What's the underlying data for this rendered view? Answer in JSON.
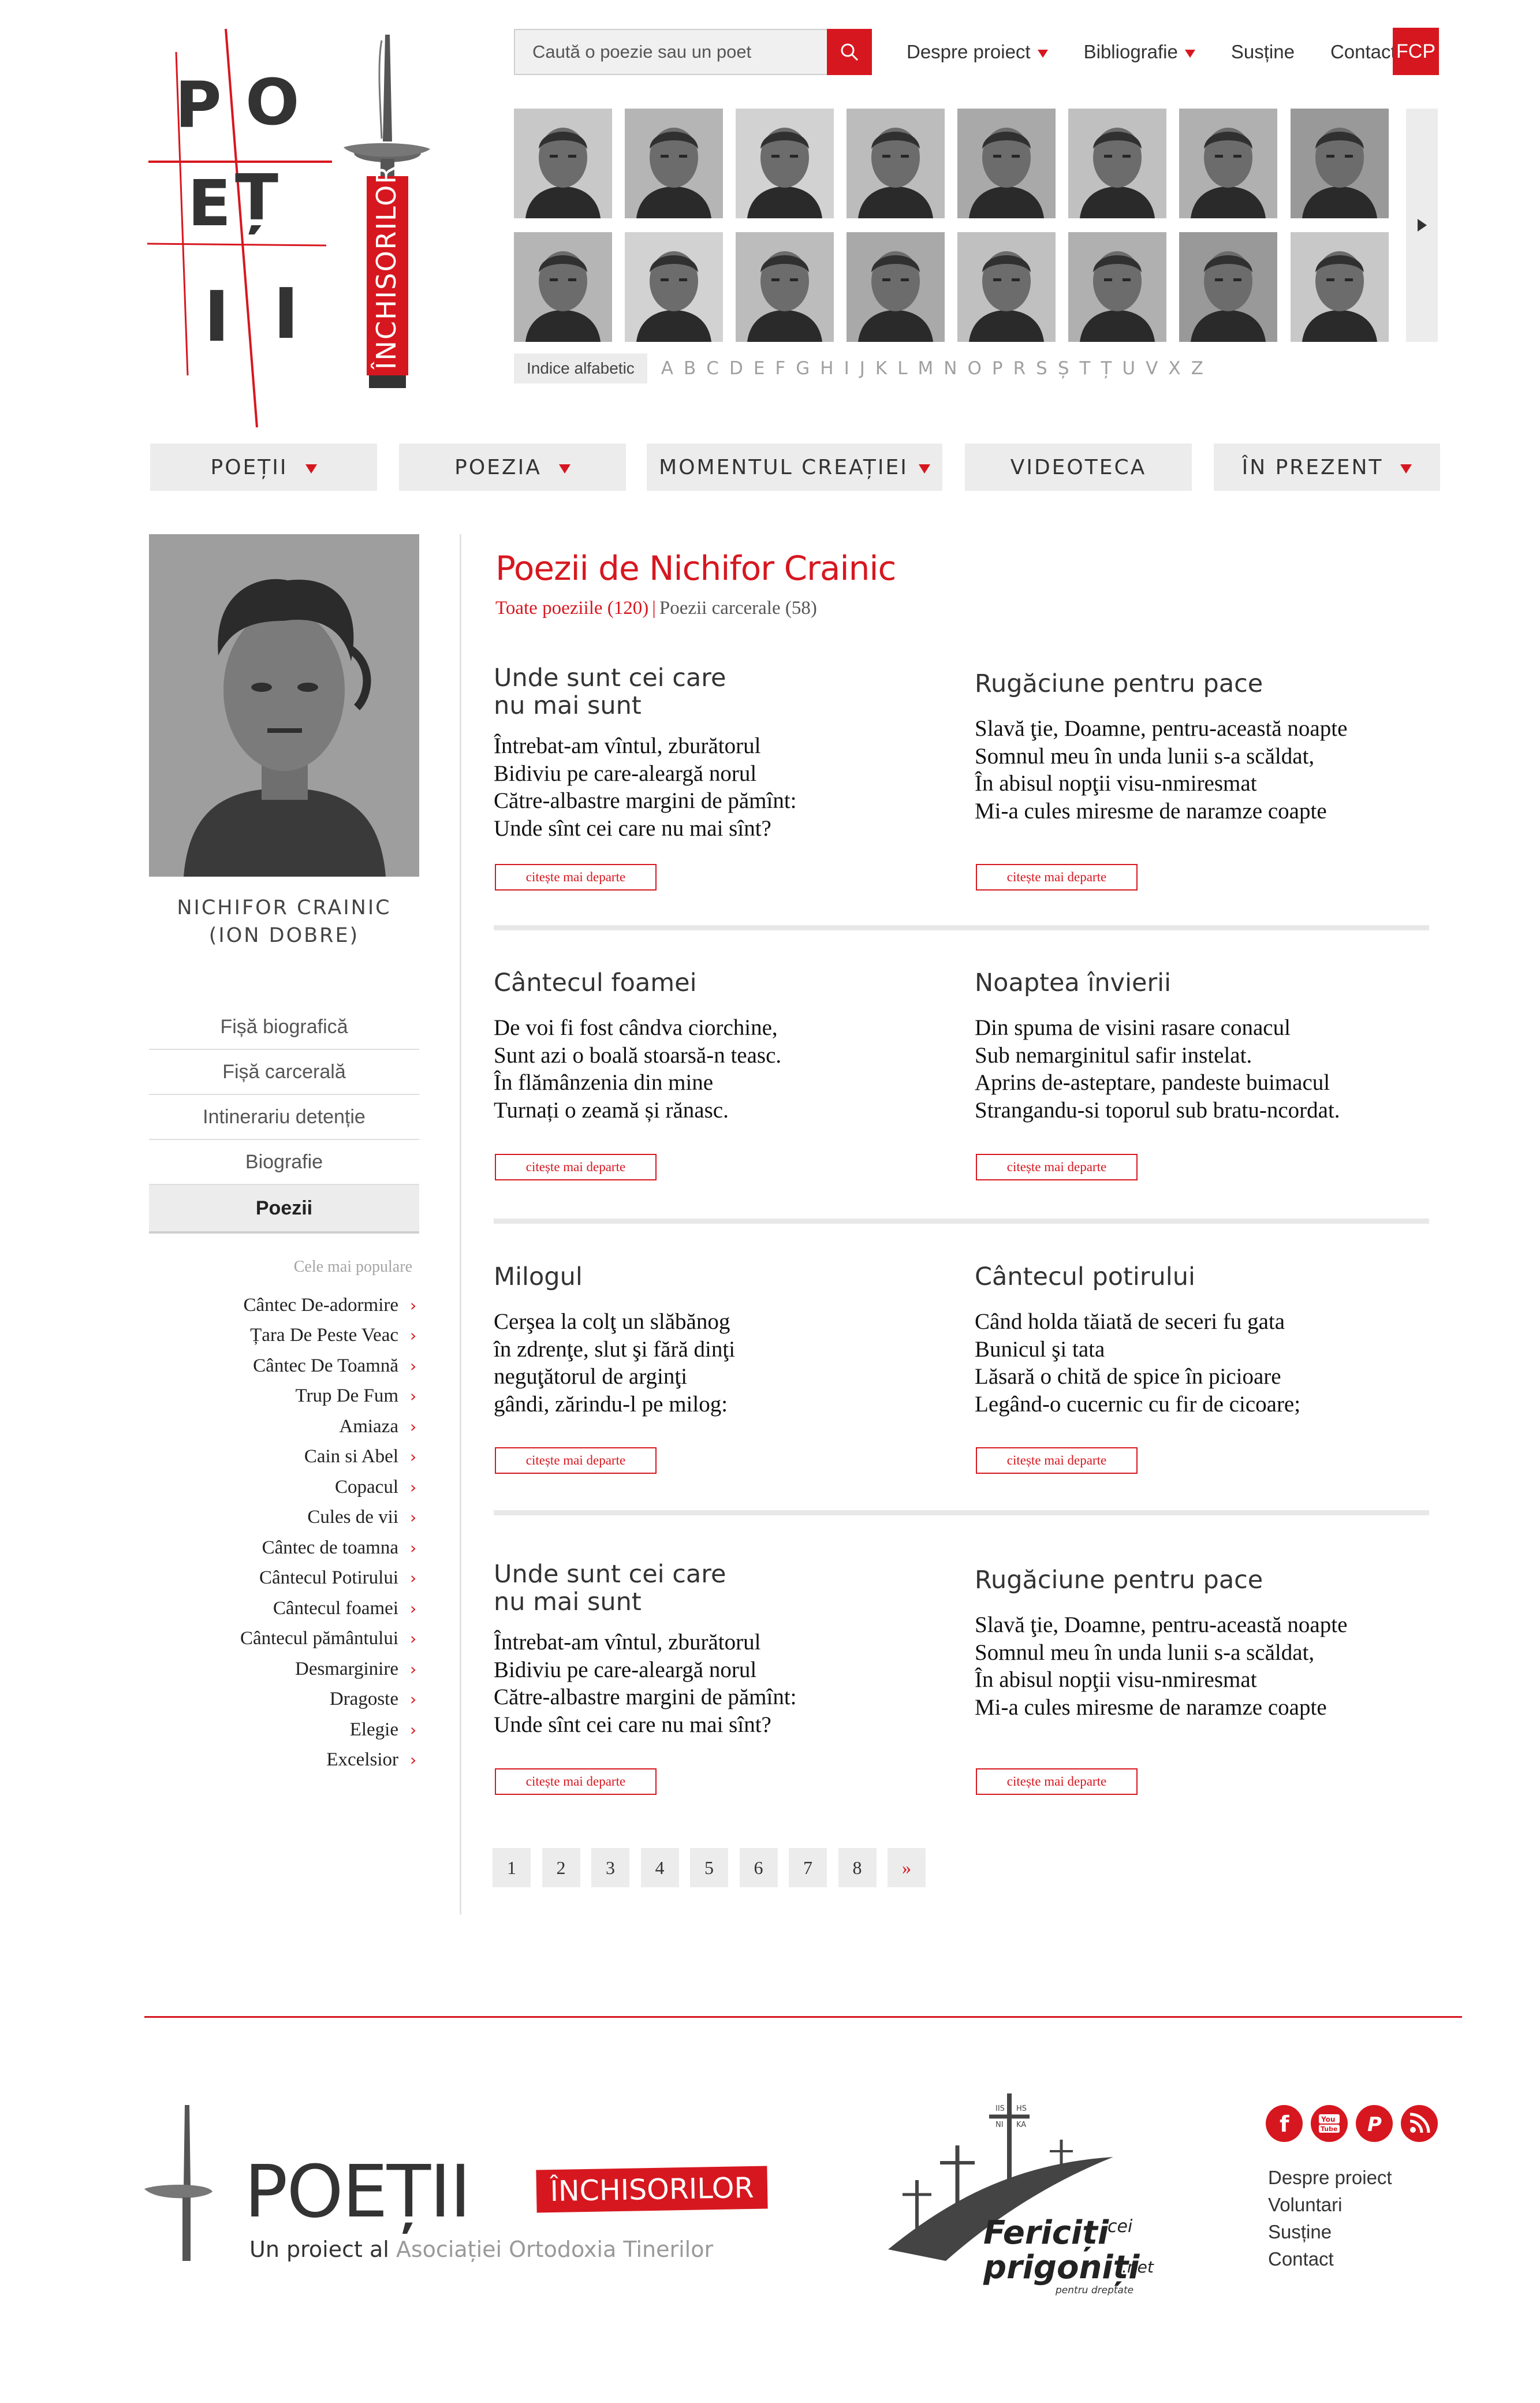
{
  "brand": {
    "logo_letters": [
      "P",
      "O",
      "E",
      "Ț",
      "I",
      "I"
    ],
    "logo_badge": "ÎNCHISORILOR"
  },
  "search": {
    "placeholder": "Caută o poezie sau un poet"
  },
  "top_nav": [
    {
      "label": "Despre proiect",
      "dropdown": true
    },
    {
      "label": "Bibliografie",
      "dropdown": true
    },
    {
      "label": "Susține",
      "dropdown": false
    },
    {
      "label": "Contact",
      "dropdown": false
    }
  ],
  "fcp_label": "FCP",
  "alphabet": {
    "label": "Indice alfabetic",
    "letters": [
      "A",
      "B",
      "C",
      "D",
      "E",
      "F",
      "G",
      "H",
      "I",
      "J",
      "K",
      "L",
      "M",
      "N",
      "O",
      "P",
      "R",
      "S",
      "Ș",
      "T",
      "Ț",
      "U",
      "V",
      "X",
      "Z"
    ]
  },
  "main_nav": [
    {
      "label": "POEȚII",
      "dropdown": true
    },
    {
      "label": "POEZIA",
      "dropdown": true
    },
    {
      "label": "MOMENTUL CREAȚIEI",
      "dropdown": true
    },
    {
      "label": "VIDEOTECA",
      "dropdown": false
    },
    {
      "label": "ÎN PREZENT",
      "dropdown": true
    }
  ],
  "poet": {
    "name": "NICHIFOR CRAINIC",
    "alias": "(ION DOBRE)"
  },
  "side_menu": [
    {
      "label": "Fișă biografică",
      "active": false
    },
    {
      "label": "Fișă carcerală",
      "active": false
    },
    {
      "label": "Intinerariu detenție",
      "active": false
    },
    {
      "label": "Biografie",
      "active": false
    },
    {
      "label": "Poezii",
      "active": true
    }
  ],
  "popular": {
    "label": "Cele mai populare",
    "items": [
      "Cântec De-adormire",
      "Țara De Peste Veac",
      "Cântec De Toamnă",
      "Trup De Fum",
      "Amiaza",
      "Cain si Abel",
      "Copacul",
      "Cules de vii",
      "Cântec de toamna",
      "Cântecul Potirului",
      "Cântecul foamei",
      "Cântecul pământului",
      "Desmarginire",
      "Dragoste",
      "Elegie",
      "Excelsior"
    ]
  },
  "content": {
    "title": "Poezii de Nichifor Crainic",
    "tab_all": "Toate poeziile (120)",
    "tab_separator": "|",
    "tab_prison": "Poezii carcerale (58)",
    "read_more": "citește mai departe",
    "poems": [
      {
        "title": [
          "Unde sunt cei care",
          "nu mai sunt"
        ],
        "verses": [
          "Întrebat-am vîntul, zburătorul",
          "Bidiviu pe care-aleargă norul",
          "Către-albastre margini de pămînt:",
          "Unde sînt cei care nu mai sînt?"
        ]
      },
      {
        "title": [
          "Rugăciune pentru pace"
        ],
        "verses": [
          "Slavă ţie, Doamne, pentru-această noapte",
          "Somnul meu în unda lunii s-a scăldat,",
          "În abisul nopţii visu-nmiresmat",
          "Mi-a cules miresme de naramze coapte"
        ]
      },
      {
        "title": [
          "Cântecul foamei"
        ],
        "verses": [
          "De voi fi fost cândva ciorchine,",
          "Sunt azi o boală stoarsă-n teasc.",
          "În flămânzenia din mine",
          "Turnați o zeamă și rănasc."
        ]
      },
      {
        "title": [
          "Noaptea învierii"
        ],
        "verses": [
          "Din spuma de visini rasare conacul",
          "Sub nemarginitul safir instelat.",
          "Aprins de-asteptare, pandeste buimacul",
          "Strangandu-si toporul sub bratu-ncordat."
        ]
      },
      {
        "title": [
          "Milogul"
        ],
        "verses": [
          "Cerşea la colţ un slăbănog",
          "în zdrenţe, slut şi fără dinţi",
          "neguţătorul de arginţi",
          "gândi, zărindu-l pe milog:"
        ]
      },
      {
        "title": [
          "Cântecul potirului"
        ],
        "verses": [
          "Când holda tăiată de seceri fu gata",
          "Bunicul şi tata",
          "Lăsară o chită de spice în picioare",
          "Legând-o cucernic cu fir de cicoare;"
        ]
      },
      {
        "title": [
          "Unde sunt cei care",
          "nu mai sunt"
        ],
        "verses": [
          "Întrebat-am vîntul, zburătorul",
          "Bidiviu pe care-aleargă norul",
          "Către-albastre margini de pămînt:",
          "Unde sînt cei care nu mai sînt?"
        ]
      },
      {
        "title": [
          "Rugăciune pentru pace"
        ],
        "verses": [
          "Slavă ţie, Doamne, pentru-această noapte",
          "Somnul meu în unda lunii s-a scăldat,",
          "În abisul nopţii visu-nmiresmat",
          "Mi-a cules miresme de naramze coapte"
        ]
      }
    ]
  },
  "pagination": [
    "1",
    "2",
    "3",
    "4",
    "5",
    "6",
    "7",
    "8",
    "»"
  ],
  "footer": {
    "logo_title": "POEȚII",
    "logo_badge": "ÎNCHISORILOR",
    "subtitle_prefix": "Un proiect al",
    "subtitle_org": "Asociației Ortodoxia Tinerilor",
    "partner": {
      "line1": "Fericiți",
      "line1b": "cei",
      "line2": "prigoniți",
      "line2b": ".net",
      "tagline": "pentru dreptate",
      "cross_labels": [
        "IIS",
        "HS",
        "NI",
        "KA"
      ]
    },
    "social": [
      "facebook-icon",
      "youtube-icon",
      "paypal-icon",
      "rss-icon"
    ],
    "links": [
      "Despre proiect",
      "Voluntari",
      "Susține",
      "Contact"
    ]
  },
  "colors": {
    "accent": "#d7171f",
    "panel": "#ececec",
    "text": "#333333"
  }
}
